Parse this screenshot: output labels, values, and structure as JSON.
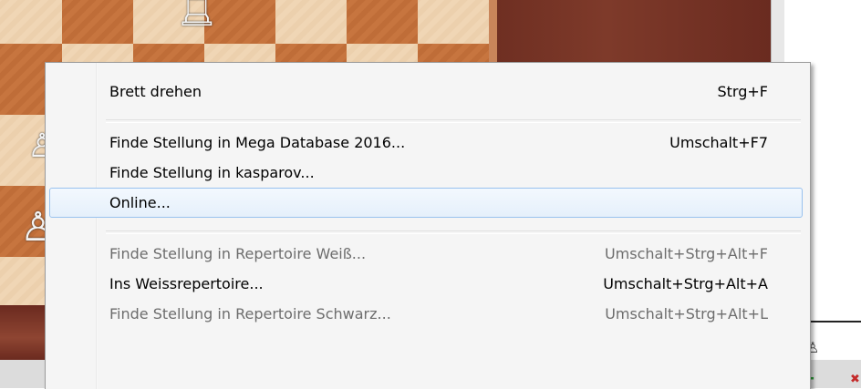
{
  "menu": {
    "items": [
      {
        "label": "Brett drehen",
        "shortcut": "Strg+F"
      },
      {
        "label": "Finde Stellung in Mega Database 2016...",
        "shortcut": "Umschalt+F7"
      },
      {
        "label": "Finde Stellung in kasparov...",
        "shortcut": ""
      },
      {
        "label": "Online...",
        "shortcut": ""
      },
      {
        "label": "Finde Stellung in Repertoire Weiß...",
        "shortcut": "Umschalt+Strg+Alt+F"
      },
      {
        "label": "Ins Weissrepertoire...",
        "shortcut": "Umschalt+Strg+Alt+A"
      },
      {
        "label": "Finde Stellung in Repertoire Schwarz...",
        "shortcut": "Umschalt+Strg+Alt+L"
      }
    ]
  },
  "icons": {
    "pawn": "pawn-icon",
    "plus": "add-icon",
    "close": "close-icon"
  },
  "colors": {
    "hover_border": "#99c2ee",
    "menu_bg": "#f5f5f5",
    "disabled_text": "#6d6d6d"
  }
}
